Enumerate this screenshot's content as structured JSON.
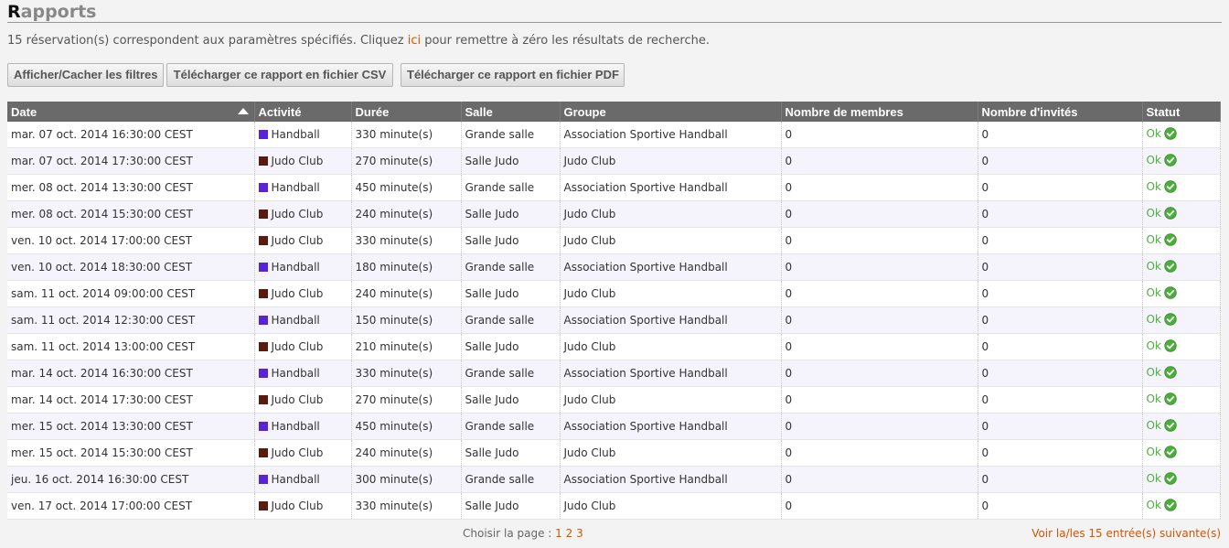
{
  "page": {
    "title_first": "R",
    "title_rest": "apports",
    "info_before": "15 réservation(s) correspondent aux paramètres spécifiés. Cliquez ",
    "info_link": "ici",
    "info_after": " pour remettre à zéro les résultats de recherche."
  },
  "buttons": {
    "filters": "Afficher/Cacher les filtres",
    "csv": "Télécharger ce rapport en fichier CSV",
    "pdf": "Télécharger ce rapport en fichier PDF"
  },
  "table": {
    "headers": [
      "Date",
      "Activité",
      "Durée",
      "Salle",
      "Groupe",
      "Nombre de membres",
      "Nombre d'invités",
      "Statut"
    ],
    "activity_colors": {
      "Handball": "#5a22d8",
      "Judo Club": "#5a1a0e"
    },
    "status_color": "#4caf3c",
    "rows": [
      [
        "mar. 07 oct. 2014 16:30:00 CEST",
        "Handball",
        "330 minute(s)",
        "Grande salle",
        "Association Sportive Handball",
        "0",
        "0",
        "Ok"
      ],
      [
        "mar. 07 oct. 2014 17:30:00 CEST",
        "Judo Club",
        "270 minute(s)",
        "Salle Judo",
        "Judo Club",
        "0",
        "0",
        "Ok"
      ],
      [
        "mer. 08 oct. 2014 13:30:00 CEST",
        "Handball",
        "450 minute(s)",
        "Grande salle",
        "Association Sportive Handball",
        "0",
        "0",
        "Ok"
      ],
      [
        "mer. 08 oct. 2014 15:30:00 CEST",
        "Judo Club",
        "240 minute(s)",
        "Salle Judo",
        "Judo Club",
        "0",
        "0",
        "Ok"
      ],
      [
        "ven. 10 oct. 2014 17:00:00 CEST",
        "Judo Club",
        "330 minute(s)",
        "Salle Judo",
        "Judo Club",
        "0",
        "0",
        "Ok"
      ],
      [
        "ven. 10 oct. 2014 18:30:00 CEST",
        "Handball",
        "180 minute(s)",
        "Grande salle",
        "Association Sportive Handball",
        "0",
        "0",
        "Ok"
      ],
      [
        "sam. 11 oct. 2014 09:00:00 CEST",
        "Judo Club",
        "240 minute(s)",
        "Salle Judo",
        "Judo Club",
        "0",
        "0",
        "Ok"
      ],
      [
        "sam. 11 oct. 2014 12:30:00 CEST",
        "Handball",
        "150 minute(s)",
        "Grande salle",
        "Association Sportive Handball",
        "0",
        "0",
        "Ok"
      ],
      [
        "sam. 11 oct. 2014 13:00:00 CEST",
        "Judo Club",
        "210 minute(s)",
        "Salle Judo",
        "Judo Club",
        "0",
        "0",
        "Ok"
      ],
      [
        "mar. 14 oct. 2014 16:30:00 CEST",
        "Handball",
        "330 minute(s)",
        "Grande salle",
        "Association Sportive Handball",
        "0",
        "0",
        "Ok"
      ],
      [
        "mar. 14 oct. 2014 17:30:00 CEST",
        "Judo Club",
        "270 minute(s)",
        "Salle Judo",
        "Judo Club",
        "0",
        "0",
        "Ok"
      ],
      [
        "mer. 15 oct. 2014 13:30:00 CEST",
        "Handball",
        "450 minute(s)",
        "Grande salle",
        "Association Sportive Handball",
        "0",
        "0",
        "Ok"
      ],
      [
        "mer. 15 oct. 2014 15:30:00 CEST",
        "Judo Club",
        "240 minute(s)",
        "Salle Judo",
        "Judo Club",
        "0",
        "0",
        "Ok"
      ],
      [
        "jeu. 16 oct. 2014 16:30:00 CEST",
        "Handball",
        "300 minute(s)",
        "Grande salle",
        "Association Sportive Handball",
        "0",
        "0",
        "Ok"
      ],
      [
        "ven. 17 oct. 2014 17:00:00 CEST",
        "Judo Club",
        "330 minute(s)",
        "Salle Judo",
        "Judo Club",
        "0",
        "0",
        "Ok"
      ]
    ]
  },
  "pager": {
    "label": "Choisir la page : ",
    "pages": [
      "1",
      "2",
      "3"
    ],
    "next_link": "Voir la/les 15 entrée(s) suivante(s)"
  }
}
